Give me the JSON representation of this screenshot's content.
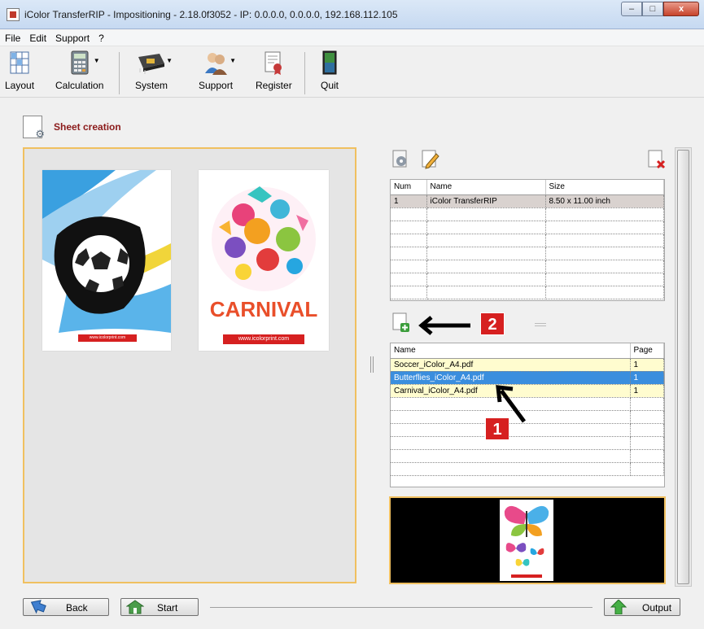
{
  "window": {
    "title": "iColor TransferRIP - Impositioning - 2.18.0f3052 - IP: 0.0.0.0, 0.0.0.0, 192.168.112.105",
    "minimize": "–",
    "maximize": "□",
    "close": "x"
  },
  "menu": [
    "File",
    "Edit",
    "Support",
    "?"
  ],
  "toolbar": {
    "layout": "Layout",
    "calculation": "Calculation",
    "system": "System",
    "support": "Support",
    "register": "Register",
    "quit": "Quit"
  },
  "section_title": "Sheet creation",
  "preview": {
    "thumb1_url": "www.icolorprint.com",
    "thumb2_word": "CARNIVAL",
    "thumb2_url": "www.icolorprint.com"
  },
  "sheets_table": {
    "columns": [
      "Num",
      "Name",
      "Size"
    ],
    "rows": [
      {
        "num": "1",
        "name": "iColor TransferRIP",
        "size": "8.50 x 11.00 inch"
      }
    ]
  },
  "files_table": {
    "columns": [
      "Name",
      "Page"
    ],
    "rows": [
      {
        "name": "Soccer_iColor_A4.pdf",
        "page": "1"
      },
      {
        "name": "Butterflies_iColor_A4.pdf",
        "page": "1"
      },
      {
        "name": "Carnival_iColor_A4.pdf",
        "page": "1"
      }
    ]
  },
  "annotations": {
    "badge1": "1",
    "badge2": "2"
  },
  "buttons": {
    "back": "Back",
    "start": "Start",
    "output": "Output"
  },
  "colors": {
    "accent_border": "#f0c060",
    "selection": "#3a8ede",
    "badge": "#d62020",
    "heading": "#8b1a1a"
  }
}
